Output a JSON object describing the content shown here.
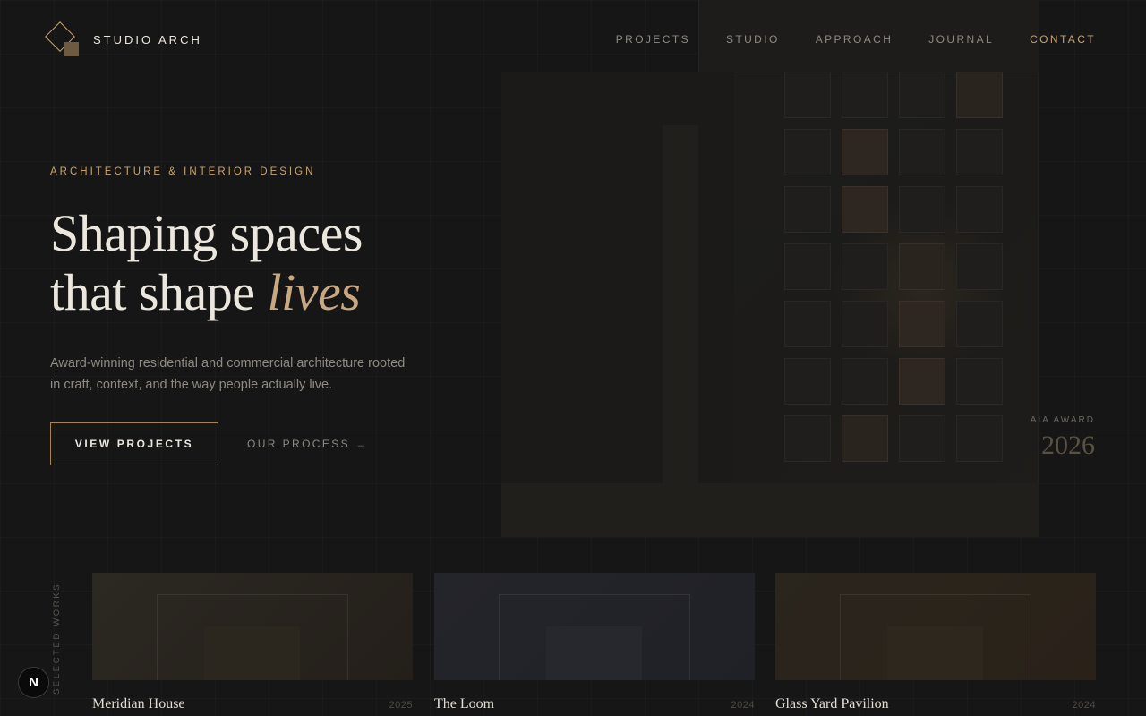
{
  "brand": {
    "name": "STUDIO ARCH",
    "accent": "#c8a46e"
  },
  "nav": {
    "items": [
      {
        "label": "PROJECTS",
        "active": false
      },
      {
        "label": "STUDIO",
        "active": false
      },
      {
        "label": "APPROACH",
        "active": false
      },
      {
        "label": "JOURNAL",
        "active": false
      },
      {
        "label": "CONTACT",
        "active": true
      }
    ]
  },
  "hero": {
    "eyebrow": "ARCHITECTURE & INTERIOR DESIGN",
    "headline_line1": "Shaping spaces",
    "headline_line2": "that shape ",
    "headline_emphasis": "lives",
    "subtitle": "Award-winning residential and commercial architecture rooted in craft, context, and the way people actually live.",
    "primary_button": "VIEW PROJECTS",
    "secondary_link": "OUR PROCESS",
    "secondary_icon": "arrow-right-icon"
  },
  "award": {
    "label": "AIA AWARD",
    "year": "2026"
  },
  "works": {
    "section_label": "SELECTED WORKS",
    "items": [
      {
        "title": "Meridian House",
        "year": "2025",
        "color": "#2a2620"
      },
      {
        "title": "The Loom",
        "year": "2024",
        "color": "#23242a"
      },
      {
        "title": "Glass Yard Pavilion",
        "year": "2024",
        "color": "#2a251d"
      }
    ]
  },
  "badge": {
    "letter": "N"
  }
}
